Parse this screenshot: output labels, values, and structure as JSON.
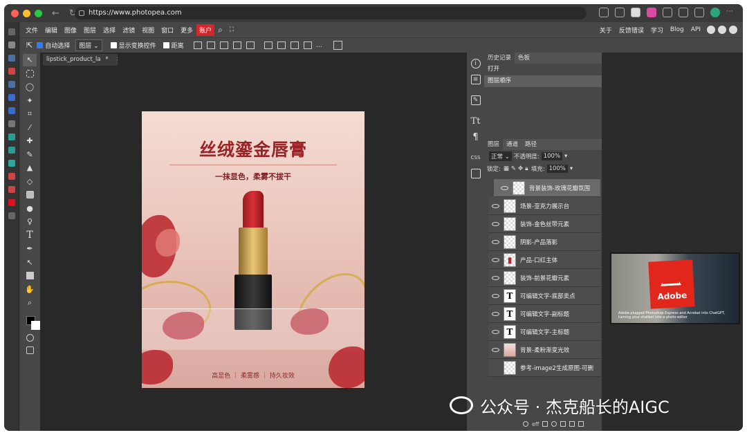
{
  "browser": {
    "url": "https://www.photopea.com",
    "traffic_colors": [
      "#ff5f57",
      "#febc2e",
      "#28c840"
    ]
  },
  "menu": {
    "items": [
      "文件",
      "编辑",
      "图像",
      "图层",
      "选择",
      "滤镜",
      "视图",
      "窗口",
      "更多"
    ],
    "account": "账户",
    "right_items": [
      "关于",
      "反馈错误",
      "学习",
      "Blog",
      "API"
    ]
  },
  "options": {
    "auto_select": "自动选择",
    "target": "图层",
    "show_transform": "显示变换控件",
    "distance": "距离"
  },
  "document": {
    "tab_label": "lipstick_product_la",
    "tab_modified": "*",
    "title": "丝绒鎏金唇膏",
    "subtitle": "一抹显色，柔雾不拔干",
    "footer": "高显色 ｜ 柔雾感 ｜ 持久妆效"
  },
  "history_panel": {
    "tabs": [
      "历史记录",
      "色板"
    ],
    "entries": [
      "打开",
      "图层顺序"
    ]
  },
  "layers_panel": {
    "tabs": [
      "图层",
      "通道",
      "路径"
    ],
    "blend_mode": "正常",
    "opacity_label": "不透明度:",
    "opacity_value": "100%",
    "lock_label": "锁定:",
    "fill_label": "填充:",
    "fill_value": "100%",
    "layers": [
      {
        "name": "背景装饰-玫瑰花瓣氛围",
        "type": "raster",
        "visible": true
      },
      {
        "name": "场景-亚克力展示台",
        "type": "raster",
        "visible": true
      },
      {
        "name": "装饰-金色丝带元素",
        "type": "raster",
        "visible": true
      },
      {
        "name": "阴影-产品落影",
        "type": "raster",
        "visible": true
      },
      {
        "name": "产品-口红主体",
        "type": "raster",
        "visible": true
      },
      {
        "name": "装饰-前景花瓣元素",
        "type": "raster",
        "visible": true
      },
      {
        "name": "可编辑文字-底部卖点",
        "type": "text",
        "visible": true
      },
      {
        "name": "可编辑文字-副标题",
        "type": "text",
        "visible": true
      },
      {
        "name": "可编辑文字-主标题",
        "type": "text",
        "visible": true
      },
      {
        "name": "背景-柔粉渐变光效",
        "type": "raster",
        "visible": true
      },
      {
        "name": "参考-image2生成原图-可删",
        "type": "raster",
        "visible": false
      }
    ],
    "text_glyph": "T"
  },
  "video_overlay": {
    "brand": "Adobe",
    "caption": "Adobe plugged Photoshop Express and Acrobat into ChatGPT, turning your chatbot into a photo editor"
  },
  "watermark": "公众号 · 杰克船长的AIGC"
}
